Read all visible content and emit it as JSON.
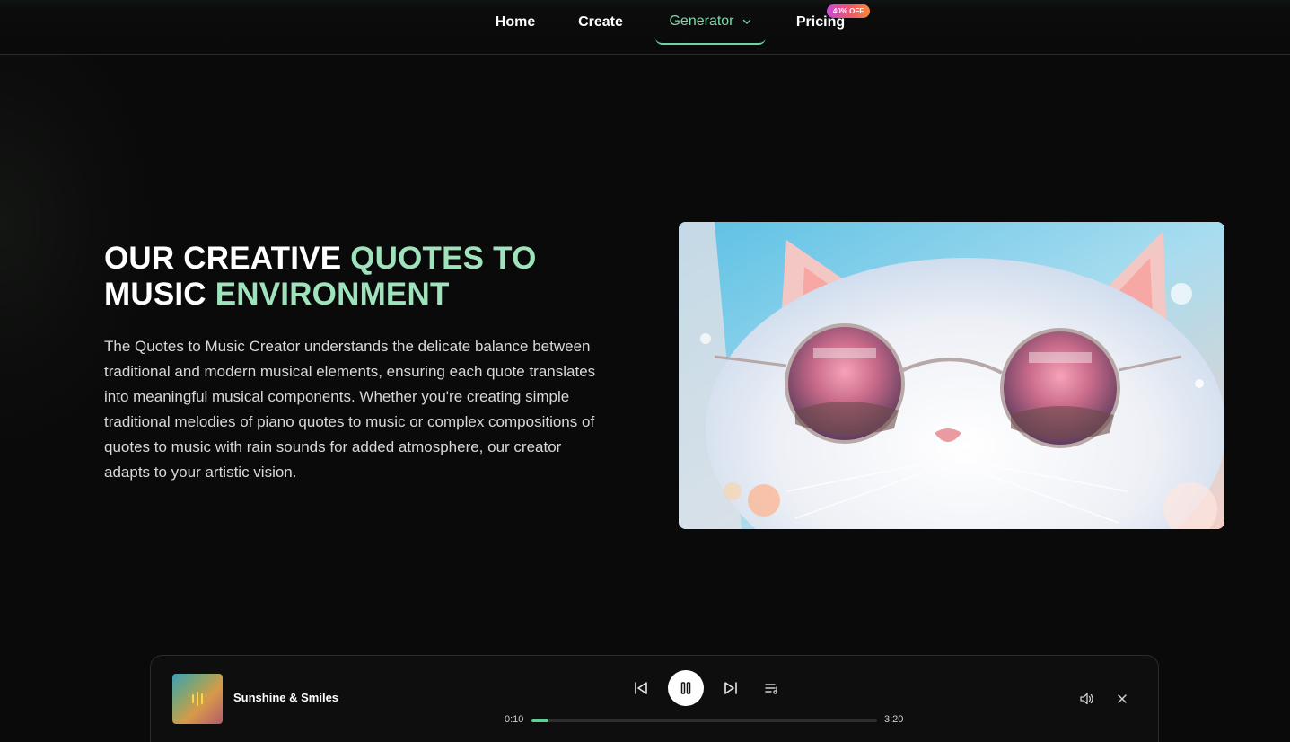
{
  "nav": {
    "items": [
      {
        "label": "Home"
      },
      {
        "label": "Create"
      },
      {
        "label": "Generator"
      },
      {
        "label": "Pricing"
      }
    ],
    "pricing_badge": "40% OFF",
    "active": "Generator"
  },
  "hero": {
    "headline_part1": "OUR CREATIVE ",
    "headline_accent1": "QUOTES TO",
    "headline_part2": "MUSIC ",
    "headline_accent2": "ENVIRONMENT",
    "body": "The Quotes to Music Creator understands the delicate balance between traditional and modern musical elements, ensuring each quote translates into meaningful musical components. Whether you're creating simple traditional melodies of piano quotes to music or complex compositions of quotes to music with rain sounds for added atmosphere, our creator adapts to your artistic vision.",
    "image_subject": "cat-wearing-sunglasses-image"
  },
  "player": {
    "track_title": "Sunshine & Smiles",
    "current_time": "0:10",
    "total_time": "3:20",
    "progress_fraction": 0.05,
    "state": "playing",
    "icons": [
      "previous-track-icon",
      "pause-icon",
      "next-track-icon",
      "queue-icon",
      "volume-icon",
      "close-icon"
    ]
  },
  "colors": {
    "background": "#0a0a0a",
    "accent_green": "#9fe3bd",
    "nav_active": "#7ed8a8",
    "progress": "#5fcf96",
    "badge_gradient": [
      "#c64ad8",
      "#f0566a",
      "#f58a3a"
    ]
  }
}
